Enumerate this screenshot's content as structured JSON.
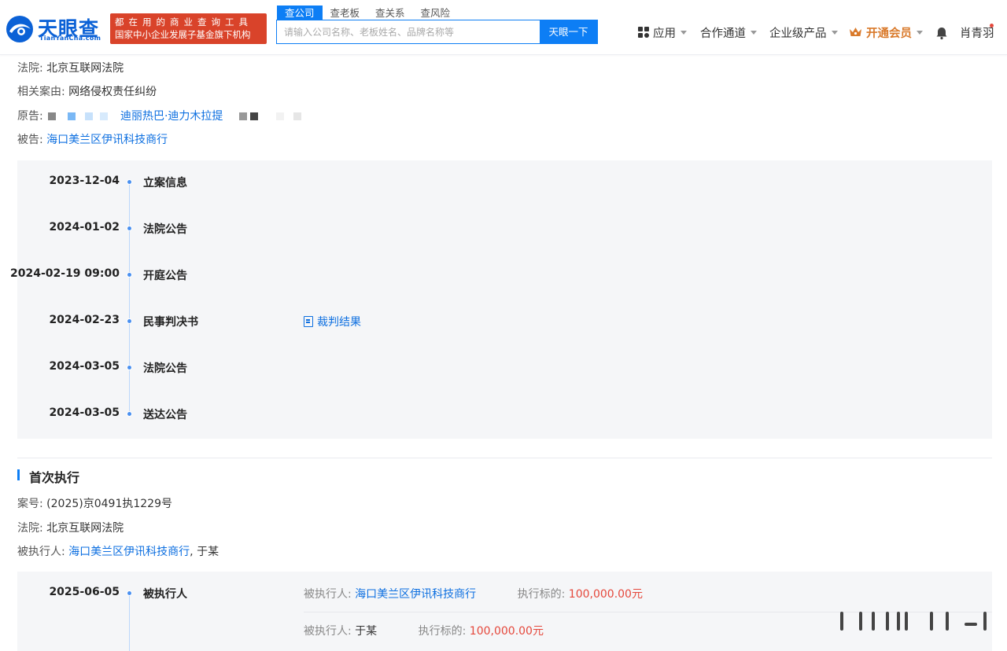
{
  "header": {
    "brand": "天眼查",
    "brand_pinyin": "TianYanCha.com",
    "slogan_line1": "都在用的商业查询工具",
    "slogan_line2": "国家中小企业发展子基金旗下机构",
    "search_tabs": [
      "查公司",
      "查老板",
      "查关系",
      "查风险"
    ],
    "search_placeholder": "请输入公司名称、老板姓名、品牌名称等",
    "search_button": "天眼一下",
    "nav": {
      "apps": "应用",
      "cooperation": "合作通道",
      "enterprise": "企业级产品",
      "vip": "开通会员",
      "user": "肖青羽"
    }
  },
  "case": {
    "court_label": "法院:",
    "court": "北京互联网法院",
    "cause_label": "相关案由:",
    "cause": "网络侵权责任纠纷",
    "plaintiff_label": "原告:",
    "plaintiff": "迪丽热巴·迪力木拉提",
    "defendant_label": "被告:",
    "defendant": "海口美兰区伊讯科技商行"
  },
  "timeline": [
    {
      "date": "2023-12-04",
      "title": "立案信息"
    },
    {
      "date": "2024-01-02",
      "title": "法院公告"
    },
    {
      "date": "2024-02-19 09:00",
      "title": "开庭公告"
    },
    {
      "date": "2024-02-23",
      "title": "民事判决书",
      "extra": "裁判结果"
    },
    {
      "date": "2024-03-05",
      "title": "法院公告"
    },
    {
      "date": "2024-03-05",
      "title": "送达公告"
    }
  ],
  "execution": {
    "section_title": "首次执行",
    "case_no_label": "案号:",
    "case_no": "(2025)京0491执1229号",
    "court_label": "法院:",
    "court": "北京互联网法院",
    "executed_label": "被执行人:",
    "executed_company": "海口美兰区伊讯科技商行",
    "executed_sep": ",",
    "executed_person": "于某",
    "event_date": "2025-06-05",
    "event_title": "被执行人",
    "rows": [
      {
        "executed_label": "被执行人:",
        "executed": "海口美兰区伊讯科技商行",
        "amount_label": "执行标的:",
        "amount": "100,000.00元"
      },
      {
        "executed_label": "被执行人:",
        "executed": "于某",
        "amount_label": "执行标的:",
        "amount": "100,000.00元"
      }
    ]
  },
  "colors": {
    "brand": "#0b61d6",
    "accent": "#0d7ef5",
    "slogan_bg": "#d9432a",
    "money": "#e5483c",
    "vip": "#d9792a",
    "link": "#0d6fe0"
  }
}
